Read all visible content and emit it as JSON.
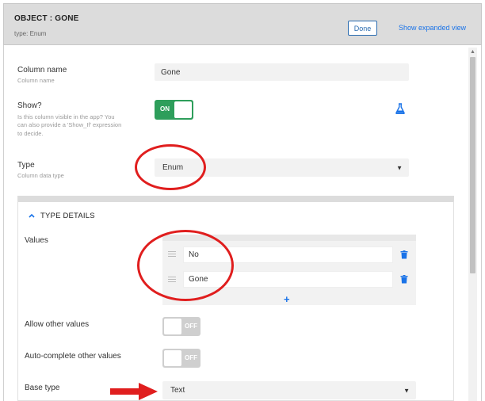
{
  "header": {
    "title": "OBJECT : GONE",
    "subtitle": "type: Enum",
    "done_label": "Done",
    "expand_label": "Show expanded view"
  },
  "column_name": {
    "label": "Column name",
    "hint": "Column name",
    "value": "Gone"
  },
  "show": {
    "label": "Show?",
    "hint_line1": "Is this column visible in the app? You",
    "hint_line2": "can also provide a 'Show_If' expression",
    "hint_line3": "to decide.",
    "toggle_label": "ON",
    "icon": "flask-icon"
  },
  "type": {
    "label": "Type",
    "hint": "Column data type",
    "value": "Enum"
  },
  "type_details": {
    "heading": "TYPE DETAILS",
    "values_label": "Values",
    "values": [
      "No",
      "Gone"
    ],
    "allow_other_label": "Allow other values",
    "allow_other_toggle": "OFF",
    "autocomplete_label": "Auto-complete other values",
    "autocomplete_toggle": "OFF",
    "base_type_label": "Base type",
    "base_type_value": "Text"
  },
  "colors": {
    "accent": "#1a73e8",
    "toggle_on": "#2e9e5b",
    "annotation_red": "#e01e1e"
  }
}
